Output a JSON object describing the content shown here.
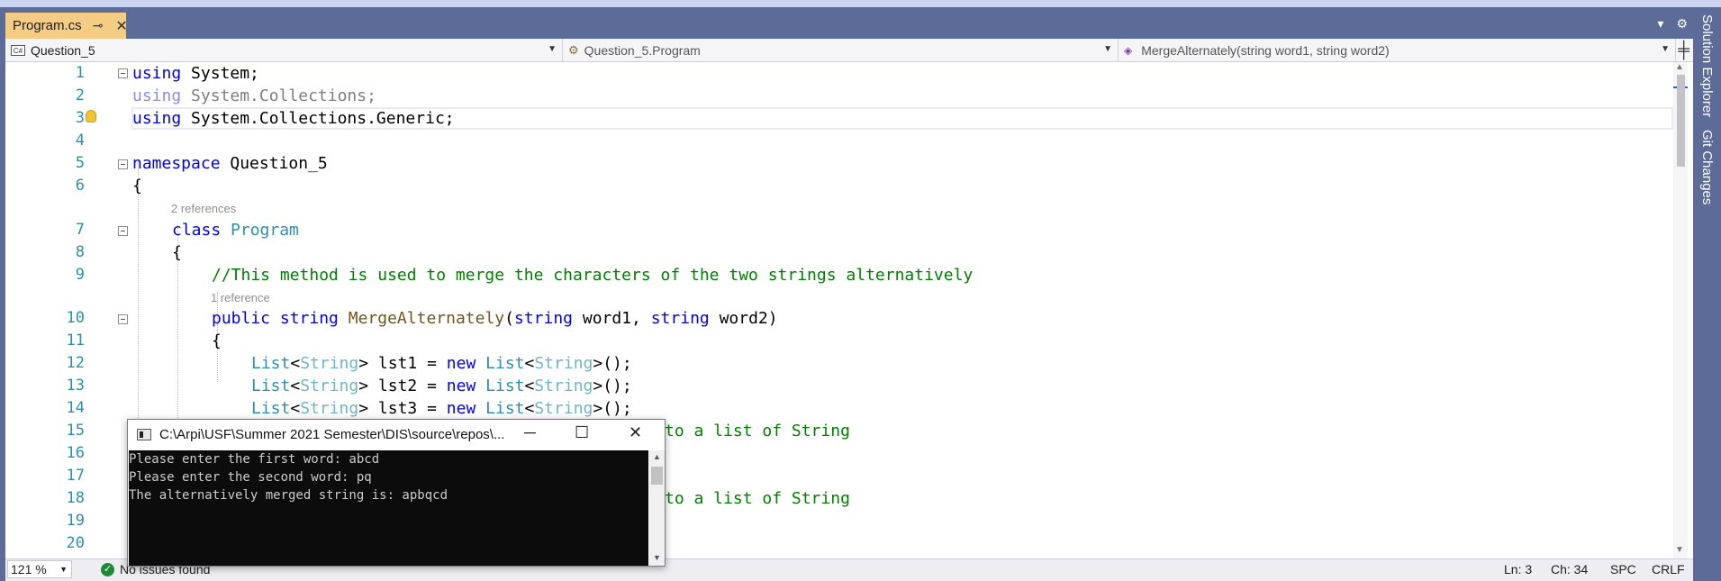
{
  "tab": {
    "filename": "Program.cs",
    "pin": "⊸",
    "close": "✕"
  },
  "window_controls": {
    "dropdown": "▾",
    "settings": "⚙"
  },
  "side_tabs": [
    "Solution Explorer",
    "Git Changes"
  ],
  "navbar": {
    "project": "Question_5",
    "type": "Question_5.Program",
    "member": "MergeAlternately(string word1, string word2)"
  },
  "code_lines": [
    {
      "n": "1"
    },
    {
      "n": "2"
    },
    {
      "n": "3"
    },
    {
      "n": "4"
    },
    {
      "n": "5"
    },
    {
      "n": "6"
    },
    {
      "n": "7"
    },
    {
      "n": "8"
    },
    {
      "n": "9"
    },
    {
      "n": "10"
    },
    {
      "n": "11"
    },
    {
      "n": "12"
    },
    {
      "n": "13"
    },
    {
      "n": "14"
    },
    {
      "n": "15"
    },
    {
      "n": "16"
    },
    {
      "n": "17"
    },
    {
      "n": "18"
    },
    {
      "n": "19"
    },
    {
      "n": "20"
    }
  ],
  "code": {
    "l1": [
      "using",
      " System;"
    ],
    "l2": [
      "using",
      " System.Collections;"
    ],
    "l3": [
      "using",
      " System.Collections.Generic;"
    ],
    "l5": [
      "namespace",
      " Question_5"
    ],
    "l6": "{",
    "ref7": "2 references",
    "l7": [
      "class",
      "Program"
    ],
    "l8": "{",
    "l9": "//This method is used to merge the characters of the two strings alternatively",
    "ref10": "1 reference",
    "l10": [
      "public",
      "string",
      "MergeAlternately",
      "(",
      "string",
      " word1, ",
      "string",
      " word2)"
    ],
    "l11": "{",
    "l12": [
      "List",
      "<",
      "String",
      "> lst1 = ",
      "new",
      "List",
      "<",
      "String",
      ">();"
    ],
    "l13": [
      "List",
      "<",
      "String",
      "> lst2 = ",
      "new",
      "List",
      "<",
      "String",
      ">();"
    ],
    "l14": [
      "List",
      "<",
      "String",
      "> lst3 = ",
      "new",
      "List",
      "<",
      "String",
      ">();"
    ],
    "l15_tail": "to a list of String",
    "l18_tail": "to a list of String"
  },
  "console": {
    "title": "C:\\Arpi\\USF\\Summer 2021 Semester\\DIS\\source\\repos\\...",
    "lines": [
      "Please enter the first word: abcd",
      "Please enter the second word: pq",
      "The alternatively merged string is: apbqcd"
    ],
    "minimize": "─",
    "maximize": "☐",
    "close": "✕"
  },
  "status": {
    "zoom": "121 %",
    "issues": "No issues found",
    "line": "Ln: 3",
    "col": "Ch: 34",
    "indent": "SPC",
    "eol": "CRLF"
  },
  "colors": {
    "keyword": "#0000ff",
    "type": "#2b91af",
    "comment": "#008000",
    "method": "#74531f",
    "line_number": "#2b91af",
    "chrome": "#5d6b99",
    "active_tab": "#f5cc84"
  }
}
